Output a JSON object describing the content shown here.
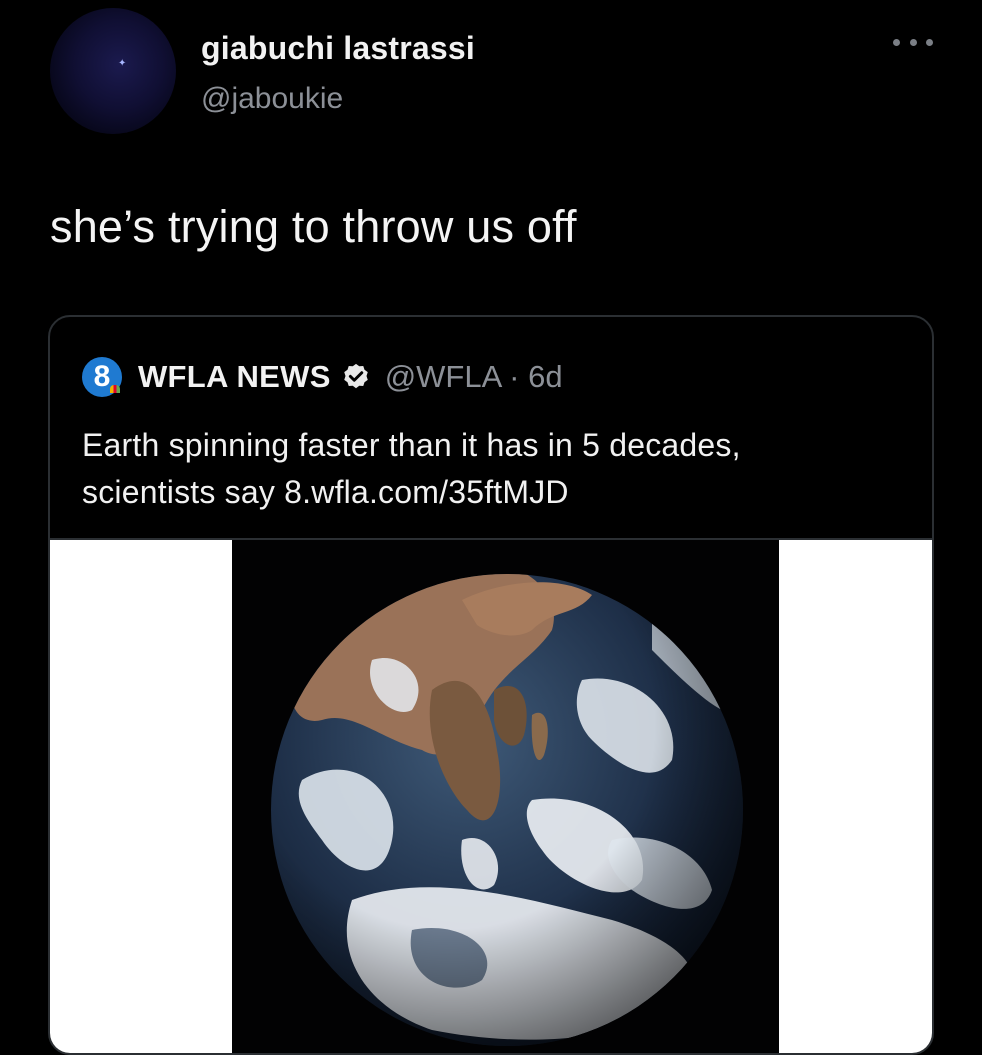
{
  "tweet": {
    "display_name": "giabuchi lastrassi",
    "handle": "@jaboukie",
    "text": "she’s trying to throw us off",
    "avatar_icon": "avatar-image",
    "more_icon": "more-options-icon"
  },
  "quoted_tweet": {
    "avatar_letter": "8",
    "name": "WFLA NEWS",
    "verified_icon": "verified-badge-icon",
    "handle_and_time": "@WFLA · 6d",
    "text_line1": "Earth spinning faster than it has in 5 decades,",
    "text_line2": "scientists say 8.wfla.com/35ftMJD",
    "media": "earth-from-space-photo"
  },
  "colors": {
    "background": "#000000",
    "text_primary": "#f2f2f2",
    "text_secondary": "#8c9097",
    "border": "#2b2f33",
    "brand_blue": "#1f7ad1"
  }
}
